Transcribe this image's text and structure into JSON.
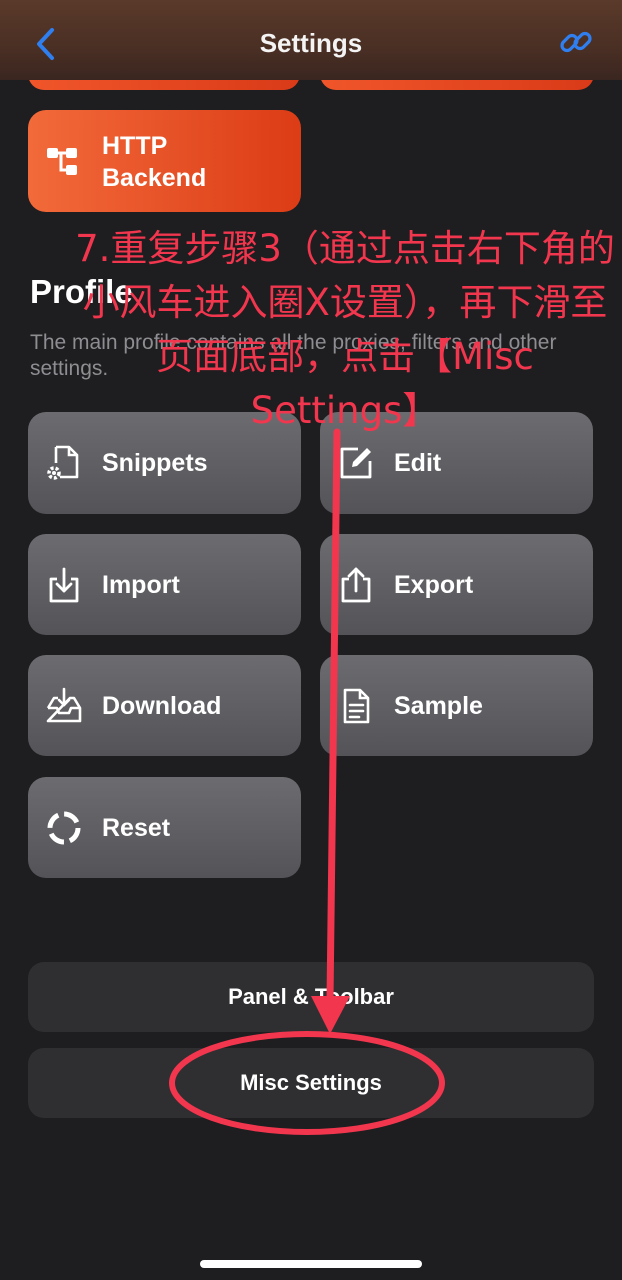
{
  "nav": {
    "title": "Settings"
  },
  "top_tiles": [
    {
      "label": "HTTP\nBackend",
      "icon": "tree-structure-icon"
    }
  ],
  "profile": {
    "title": "Profile",
    "description": "The main profile contains all the proxies, filters and other settings."
  },
  "grid": [
    {
      "label": "Snippets",
      "icon": "file-gear-icon"
    },
    {
      "label": "Edit",
      "icon": "edit-icon"
    },
    {
      "label": "Import",
      "icon": "import-icon"
    },
    {
      "label": "Export",
      "icon": "export-icon"
    },
    {
      "label": "Download",
      "icon": "download-tray-icon"
    },
    {
      "label": "Sample",
      "icon": "document-icon"
    },
    {
      "label": "Reset",
      "icon": "reset-circle-icon"
    }
  ],
  "buttons": {
    "panel_toolbar": "Panel & Toolbar",
    "misc_settings": "Misc Settings"
  },
  "annotation": {
    "text": "7.重复步骤3（通过点击右下角的小风车进入圈X设置），再下滑至页面底部，点击【Misc Settings】",
    "color": "#f2364e"
  },
  "colors": {
    "accent_blue": "#2f7ff0",
    "tile_orange": "#f0562a",
    "tile_gray": "#5e5e62",
    "background": "#1e1e20"
  }
}
